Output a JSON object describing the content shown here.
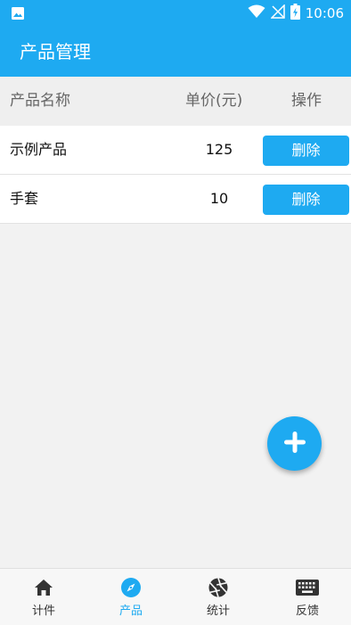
{
  "status_bar": {
    "time": "10:06"
  },
  "app_bar": {
    "title": "产品管理"
  },
  "table": {
    "headers": {
      "name": "产品名称",
      "price": "单价(元)",
      "action": "操作"
    },
    "rows": [
      {
        "name": "示例产品",
        "price": "125",
        "action": "删除"
      },
      {
        "name": "手套",
        "price": "10",
        "action": "删除"
      }
    ]
  },
  "fab": {
    "icon": "plus-icon"
  },
  "tab_bar": {
    "items": [
      {
        "label": "计件",
        "icon": "home-icon",
        "active": false
      },
      {
        "label": "产品",
        "icon": "compass-icon",
        "active": true
      },
      {
        "label": "统计",
        "icon": "aperture-icon",
        "active": false
      },
      {
        "label": "反馈",
        "icon": "keyboard-icon",
        "active": false
      }
    ]
  },
  "colors": {
    "accent": "#1eaaf1",
    "background": "#f2f2f2"
  }
}
